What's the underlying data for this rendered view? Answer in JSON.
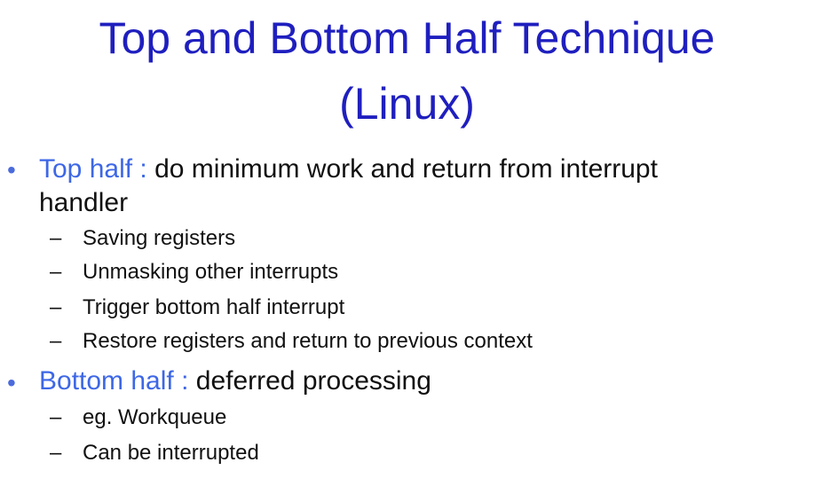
{
  "slide": {
    "title_line1": "Top and Bottom Half Technique",
    "title_line2": "(Linux)",
    "bullets": [
      {
        "bullet_symbol": "•",
        "label": "Top half :",
        "text_line1": " do minimum work and return from interrupt",
        "text_line2": "handler",
        "subitems": [
          {
            "dash": "–",
            "text": "Saving registers"
          },
          {
            "dash": "–",
            "text": "Unmasking other interrupts"
          },
          {
            "dash": "–",
            "text": "Trigger bottom half interrupt"
          },
          {
            "dash": "–",
            "text": "Restore registers and return to previous context"
          }
        ]
      },
      {
        "bullet_symbol": "•",
        "label": "Bottom half :",
        "text_line1": " deferred processing",
        "subitems": [
          {
            "dash": "–",
            "text": "eg. Workqueue"
          },
          {
            "dash": "–",
            "text": "Can be interrupted"
          }
        ]
      }
    ]
  },
  "colors": {
    "title": "#1f1fbf",
    "accent": "#3d67e6",
    "bullet": "#4b6bdc",
    "body_text": "#111111",
    "background": "#ffffff"
  }
}
